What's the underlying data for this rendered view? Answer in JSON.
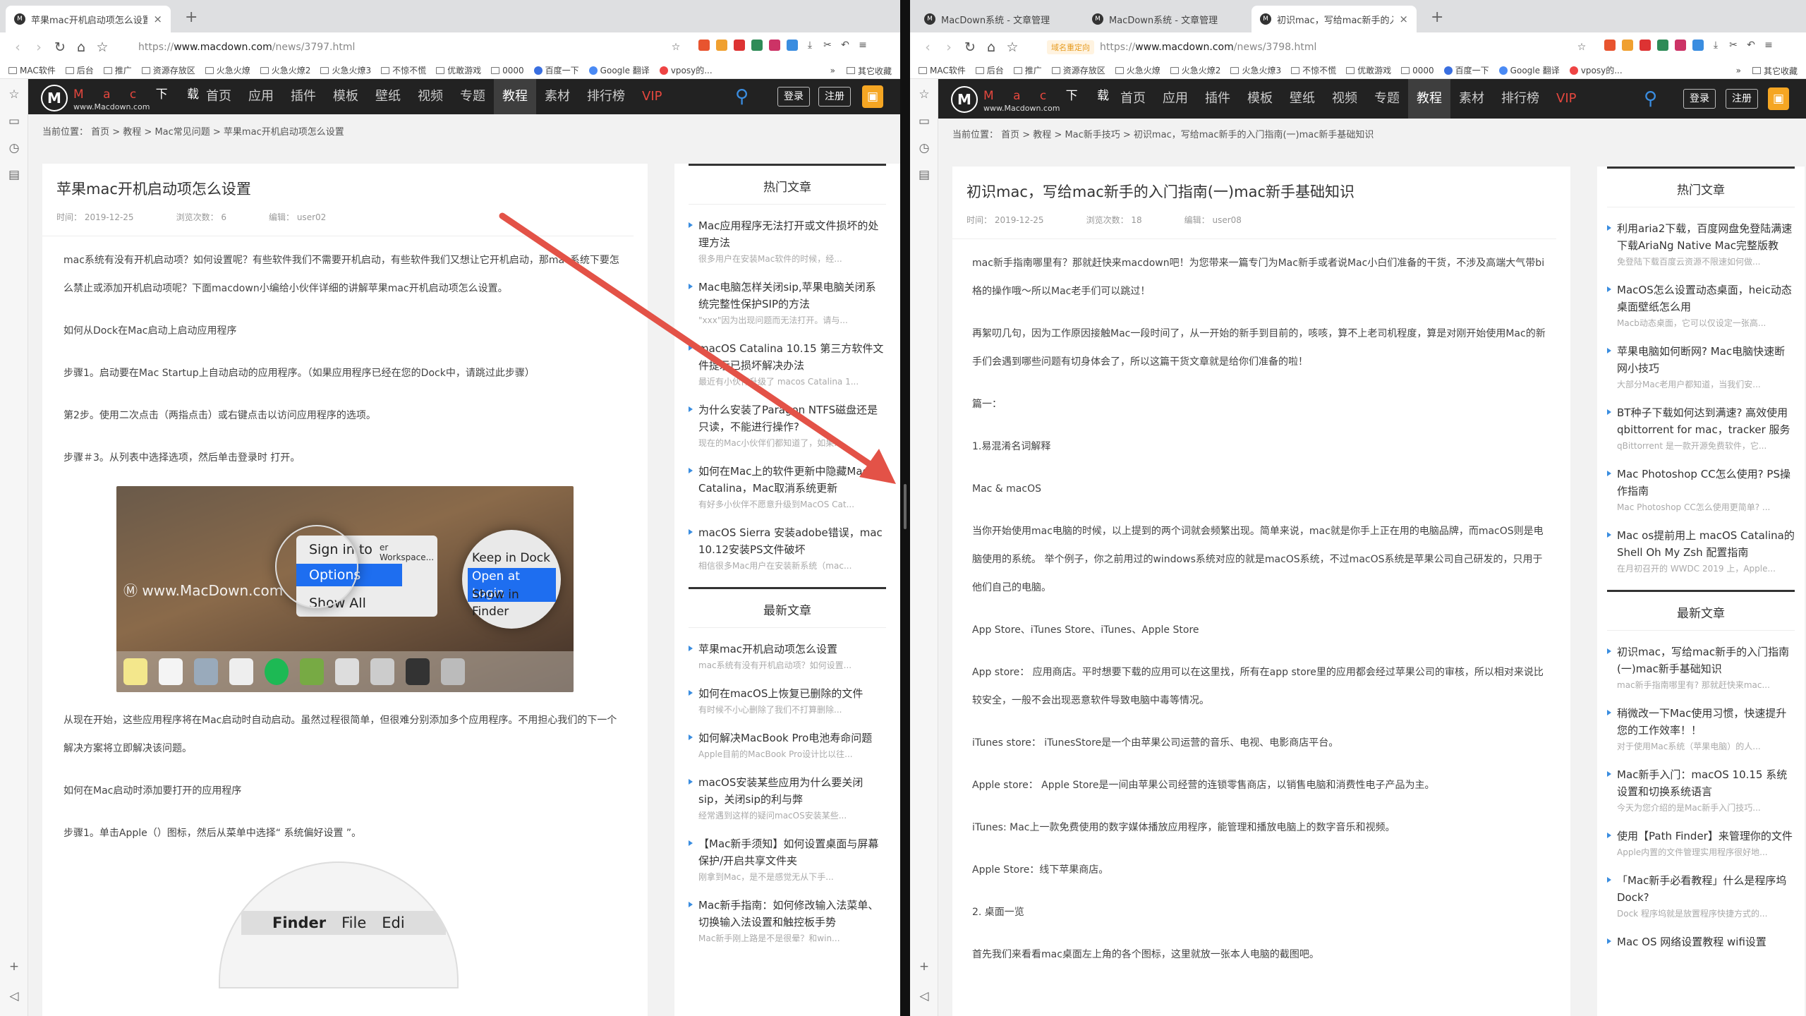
{
  "left": {
    "tabs": [
      {
        "title": "苹果mac开机启动项怎么设置 - M",
        "close": "×"
      }
    ],
    "new_tab": "+",
    "url": {
      "prefix": "https://",
      "host": "www.macdown.com",
      "path": "/news/3797.html"
    },
    "bookmarks": [
      "MAC软件",
      "后台",
      "推广",
      "资源存放区",
      "火急火燎",
      "火急火燎2",
      "火急火燎3",
      "不惊不慌",
      "优敢游戏",
      "0000",
      "百度一下",
      "Google 翻译",
      "vposy的..."
    ],
    "bookmarks_more": "»",
    "bookmarks_other": "其它收藏",
    "site": {
      "logo_letter": "M",
      "logo_red": "M a c",
      "logo_white": "下 载",
      "logo_url": "www.Macdown.com",
      "nav": [
        "首页",
        "应用",
        "插件",
        "模板",
        "壁纸",
        "视频",
        "专题",
        "教程",
        "素材",
        "排行榜",
        "VIP"
      ],
      "login": "登录",
      "register": "注册"
    },
    "breadcrumb": "当前位置： 首页 > 教程 > Mac常见问题 > 苹果mac开机启动项怎么设置",
    "article": {
      "title": "苹果mac开机启动项怎么设置",
      "time": "时间： 2019-12-25",
      "views": "浏览次数： 6",
      "editor": "编辑： user02",
      "paragraphs": [
        "mac系统有没有开机启动项？如何设置呢？有些软件我们不需要开机启动，有些软件我们又想让它开机启动，那mac系统下要怎么禁止或添加开机启动项呢？下面macdown小编给小伙伴详细的讲解苹果mac开机启动项怎么设置。",
        "如何从Dock在Mac启动上启动应用程序",
        "步骤1。启动要在Mac Startup上自动启动的应用程序。（如果应用程序已经在您的Dock中，请跳过此步骤）",
        "第2步。使用二次点击（两指点击）或右键点击以访问应用程序的选项。",
        "步骤＃3。从列表中选择选项，然后单击登录时 打开。"
      ],
      "image1": {
        "watermark": "www.MacDown.com",
        "menu": [
          "Sign in to",
          "Options",
          "Show All"
        ],
        "submenu_hint": "er Workspace...",
        "zoom": [
          "Keep in Dock",
          "Open at Login",
          "Show in Finder"
        ]
      },
      "paragraphs2": [
        "从现在开始，这些应用程序将在Mac启动时自动启动。虽然过程很简单，但很难分别添加多个应用程序。不用担心我们的下一个解决方案将立即解决该问题。",
        "如何在Mac启动时添加要打开的应用程序",
        "步骤1。单击Apple（）图标，然后从菜单中选择“ 系统偏好设置 ”。"
      ],
      "image2": {
        "apple": "",
        "menu": [
          "Finder",
          "File",
          "Edi"
        ]
      }
    },
    "sidebar": {
      "hot_title": "热门文章",
      "hot": [
        {
          "title": "Mac应用程序无法打开或文件损坏的处理方法",
          "summary": "很多用户在安装Mac软件的时候，经..."
        },
        {
          "title": "Mac电脑怎样关闭sip,苹果电脑关闭系统完整性保护SIP的方法",
          "summary": "\"xxx\"因为出现问题而无法打开。请与..."
        },
        {
          "title": "macOS Catalina 10.15 第三方软件文件提示已损坏解决办法",
          "summary": "最近有小伙伴升级了 macos Catalina 1..."
        },
        {
          "title": "为什么安装了Paragon NTFS磁盘还是只读，不能进行操作?",
          "summary": "现在的Mac小伙伴们都知道了，如果..."
        },
        {
          "title": "如何在Mac上的软件更新中隐藏MacOS Catalina，Mac取消系统更新",
          "summary": "有好多小伙伴不愿意升级到MacOS Cat..."
        },
        {
          "title": "macOS Sierra 安装adobe错误，mac 10.12安装PS文件破坏",
          "summary": "相信很多Mac用户在安装新系统（mac..."
        }
      ],
      "new_title": "最新文章",
      "new": [
        {
          "title": "苹果mac开机启动项怎么设置",
          "summary": "mac系统有没有开机启动项？如何设置..."
        },
        {
          "title": "如何在macOS上恢复已删除的文件",
          "summary": "有时候不小心删除了我们不打算删除..."
        },
        {
          "title": "如何解决MacBook Pro电池寿命问题",
          "summary": "Apple目前的MacBook Pro设计比以往..."
        },
        {
          "title": "macOS安装某些应用为什么要关闭sip，关闭sip的利与弊",
          "summary": "经常遇到这样的疑问macOS安装某些..."
        },
        {
          "title": "【Mac新手须知】如何设置桌面与屏幕保护/开启共享文件夹",
          "summary": "刚拿到Mac，是不是感觉无从下手..."
        },
        {
          "title": "Mac新手指南：如何修改输入法菜单、切换输入法设置和触控板手势",
          "summary": "Mac新手刚上路是不是很晕？和win..."
        }
      ]
    }
  },
  "right": {
    "tabs": [
      {
        "title": "MacDown系统 - 文章管理",
        "close": ""
      },
      {
        "title": "MacDown系统 - 文章管理",
        "close": ""
      },
      {
        "title": "初识mac，写给mac新手的入门指",
        "close": "×"
      }
    ],
    "new_tab": "+",
    "url": {
      "badge": "域名重定向",
      "prefix": "https://",
      "host": "www.macdown.com",
      "path": "/news/3798.html"
    },
    "bookmarks": [
      "MAC软件",
      "后台",
      "推广",
      "资源存放区",
      "火急火燎",
      "火急火燎2",
      "火急火燎3",
      "不惊不慌",
      "优敢游戏",
      "0000",
      "百度一下",
      "Google 翻译",
      "vposy的..."
    ],
    "bookmarks_more": "»",
    "bookmarks_other": "其它收藏",
    "site": {
      "logo_letter": "M",
      "logo_red": "M a c",
      "logo_white": "下 载",
      "logo_url": "www.Macdown.com",
      "nav": [
        "首页",
        "应用",
        "插件",
        "模板",
        "壁纸",
        "视频",
        "专题",
        "教程",
        "素材",
        "排行榜",
        "VIP"
      ],
      "login": "登录",
      "register": "注册"
    },
    "breadcrumb": "当前位置： 首页 > 教程 > Mac新手技巧 > 初识mac，写给mac新手的入门指南(一)mac新手基础知识",
    "article": {
      "title": "初识mac，写给mac新手的入门指南(一)mac新手基础知识",
      "time": "时间： 2019-12-25",
      "views": "浏览次数： 18",
      "editor": "编辑： user08",
      "paragraphs": [
        "mac新手指南哪里有？那就赶快来macdown吧！为您带来一篇专门为Mac新手或者说Mac小白们准备的干货，不涉及高端大气带bi格的操作哦～所以Mac老手们可以跳过！",
        "再絮叨几句，因为工作原因接触Mac一段时间了，从一开始的新手到目前的，咳咳，算不上老司机程度，算是对刚开始使用Mac的新手们会遇到哪些问题有切身体会了，所以这篇干货文章就是给你们准备的啦！",
        "篇一：",
        "1.易混淆名词解释",
        "Mac & macOS",
        "当你开始使用mac电脑的时候，以上提到的两个词就会频繁出现。简单来说，mac就是你手上正在用的电脑品牌，而macOS则是电脑使用的系统。 举个例子，你之前用过的windows系统对应的就是macOS系统，不过macOS系统是苹果公司自己研发的，只用于他们自己的电脑。",
        "App Store、iTunes Store、iTunes、Apple Store",
        "App store： 应用商店。平时想要下载的应用可以在这里找，所有在app store里的应用都会经过苹果公司的审核，所以相对来说比较安全，一般不会出现恶意软件导致电脑中毒等情况。",
        "iTunes store： iTunesStore是一个由苹果公司运营的音乐、电视、电影商店平台。",
        "Apple store： Apple Store是一间由苹果公司经营的连锁零售商店，以销售电脑和消费性电子产品为主。",
        "iTunes: Mac上一款免费使用的数字媒体播放应用程序，能管理和播放电脑上的数字音乐和视频。",
        "Apple Store：线下苹果商店。",
        "2. 桌面一览",
        "首先我们来看看mac桌面左上角的各个图标，这里就放一张本人电脑的截图吧。"
      ]
    },
    "sidebar": {
      "hot_title": "热门文章",
      "hot": [
        {
          "title": "利用aria2下载，百度网盘免登陆满速下载AriaNg Native Mac完整版教",
          "summary": "免登陆下载百度云资源不限速如何做..."
        },
        {
          "title": "MacOS怎么设置动态桌面，heic动态桌面壁纸怎么用",
          "summary": "Macb动态桌面，它可以仅设定一张高..."
        },
        {
          "title": "苹果电脑如何断网? Mac电脑快速断网小技巧",
          "summary": "大部分Mac老用户都知道，当我们安..."
        },
        {
          "title": "BT种子下载如何达到满速? 高效使用qbittorrent for mac，tracker 服务",
          "summary": "qBittorrent 是一款开源免费软件，它..."
        },
        {
          "title": "Mac Photoshop CC怎么使用? PS操作指南",
          "summary": "Mac Photoshop CC怎么使用更简单? ..."
        },
        {
          "title": "Mac os提前用上 macOS Catalina的Shell Oh My Zsh 配置指南",
          "summary": "在月初召开的 WWDC 2019 上，Apple..."
        }
      ],
      "new_title": "最新文章",
      "new": [
        {
          "title": "初识mac，写给mac新手的入门指南(一)mac新手基础知识",
          "summary": "mac新手指南哪里有? 那就赶快来mac..."
        },
        {
          "title": "稍微改一下Mac使用习惯，快速提升您的工作效率！！",
          "summary": "对于使用Mac系统（苹果电脑）的人..."
        },
        {
          "title": "Mac新手入门：macOS 10.15 系统设置和切换系统语言",
          "summary": "今天为您介绍的是Mac新手入门技巧..."
        },
        {
          "title": "使用【Path Finder】来管理你的文件",
          "summary": "Apple内置的文件管理实用程序很好地..."
        },
        {
          "title": "「Mac新手必看教程」什么是程序坞 Dock?",
          "summary": "Dock 程序坞就是放置程序快捷方式的..."
        },
        {
          "title": "Mac OS 网络设置教程 wifi设置",
          "summary": ""
        }
      ]
    }
  },
  "colors": {
    "accent": "#3a8de0",
    "brand_red": "#e5473e",
    "header_bg": "#222222",
    "arrow": "#e35247"
  }
}
